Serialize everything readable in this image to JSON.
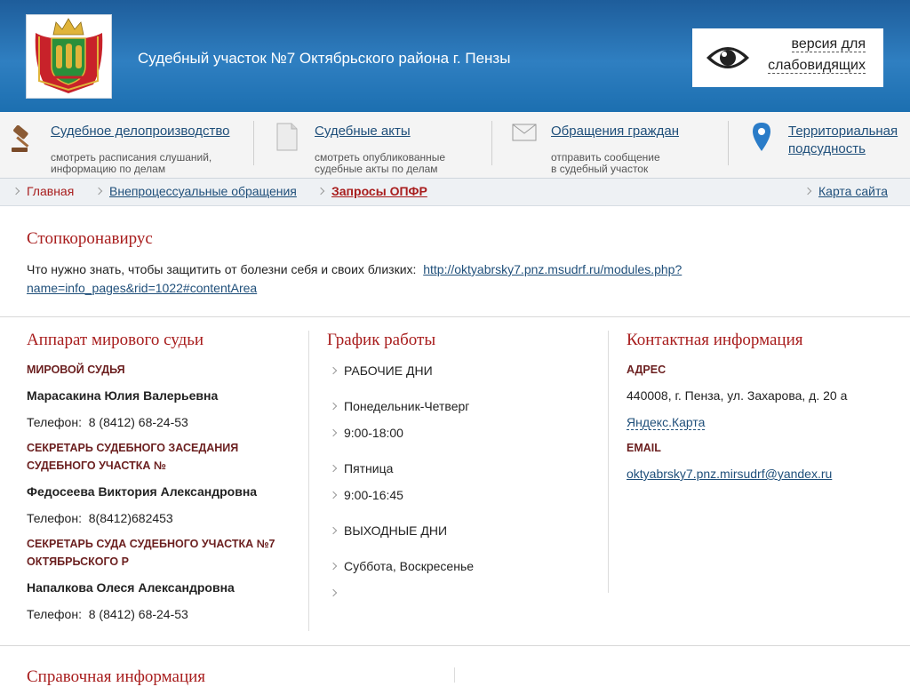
{
  "header": {
    "title": "Судебный участок №7 Октябрьского района г. Пензы",
    "accessibility_line1": "версия для",
    "accessibility_line2": "слабовидящих"
  },
  "nav": {
    "items": [
      {
        "title": "Судебное делопроизводство",
        "sub1": "смотреть расписания слушаний,",
        "sub2": "информацию по делам",
        "icon": "gavel-icon"
      },
      {
        "title": "Судебные акты",
        "sub1": "смотреть опубликованные",
        "sub2": "судебные акты по делам",
        "icon": "document-icon"
      },
      {
        "title": "Обращения граждан",
        "sub1": "отправить сообщение",
        "sub2": "в судебный участок",
        "icon": "envelope-icon"
      },
      {
        "title1": "Территориальная",
        "title2": "подсудность",
        "icon": "map-pin-icon"
      }
    ]
  },
  "breadcrumbs": {
    "home": "Главная",
    "section": "Внепроцессуальные обращения",
    "current": "Запросы ОПФР",
    "sitemap": "Карта сайта"
  },
  "stop": {
    "title": "Стопкоронавирус",
    "text": "Что нужно знать, чтобы защитить от болезни себя и своих близких:",
    "link_line1": "http://oktyabrsky7.pnz.msudrf.ru/modules.php?",
    "link_line2": "name=info_pages&rid=1022#contentArea"
  },
  "apparatus": {
    "title": "Аппарат мирового судьи",
    "judge_label": "МИРОВОЙ СУДЬЯ",
    "judge_name": "Марасакина Юлия Валерьевна",
    "judge_phone_label": "Телефон:",
    "judge_phone": "8 (8412) 68-24-53",
    "secretary_label1": "СЕКРЕТАРЬ СУДЕБНОГО ЗАСЕДАНИЯ",
    "secretary_label2": "СУДЕБНОГО УЧАСТКА №",
    "secretary_name": "Федосеева Виктория Александровна",
    "secretary_phone_label": "Телефон:",
    "secretary_phone": "8(8412)682453",
    "court_secretary_label1": "СЕКРЕТАРЬ СУДА СУДЕБНОГО УЧАСТКА №7",
    "court_secretary_label2": "ОКТЯБРЬСКОГО Р",
    "court_secretary_name": "Напалкова Олеся Александровна",
    "court_secretary_phone_label": "Телефон:",
    "court_secretary_phone": "8 (8412) 68-24-53"
  },
  "schedule": {
    "title": "График работы",
    "rows": [
      "РАБОЧИЕ ДНИ",
      "Понедельник-Четверг",
      "9:00-18:00",
      "Пятница",
      "9:00-16:45",
      "ВЫХОДНЫЕ ДНИ",
      "Суббота, Воскресенье",
      ""
    ]
  },
  "contacts": {
    "title": "Контактная информация",
    "address_label": "АДРЕС",
    "address": "440008, г. Пенза, ул. Захарова, д. 20 а",
    "map_link": "Яндекс.Карта",
    "email_label": "EMAIL",
    "email": "oktyabrsky7.pnz.mirsudrf@yandex.ru"
  },
  "reference": {
    "title": "Справочная информация"
  },
  "colors": {
    "header_blue": "#2f7fc1",
    "accent_red": "#a81d1d",
    "link_blue": "#1f4f7a"
  }
}
